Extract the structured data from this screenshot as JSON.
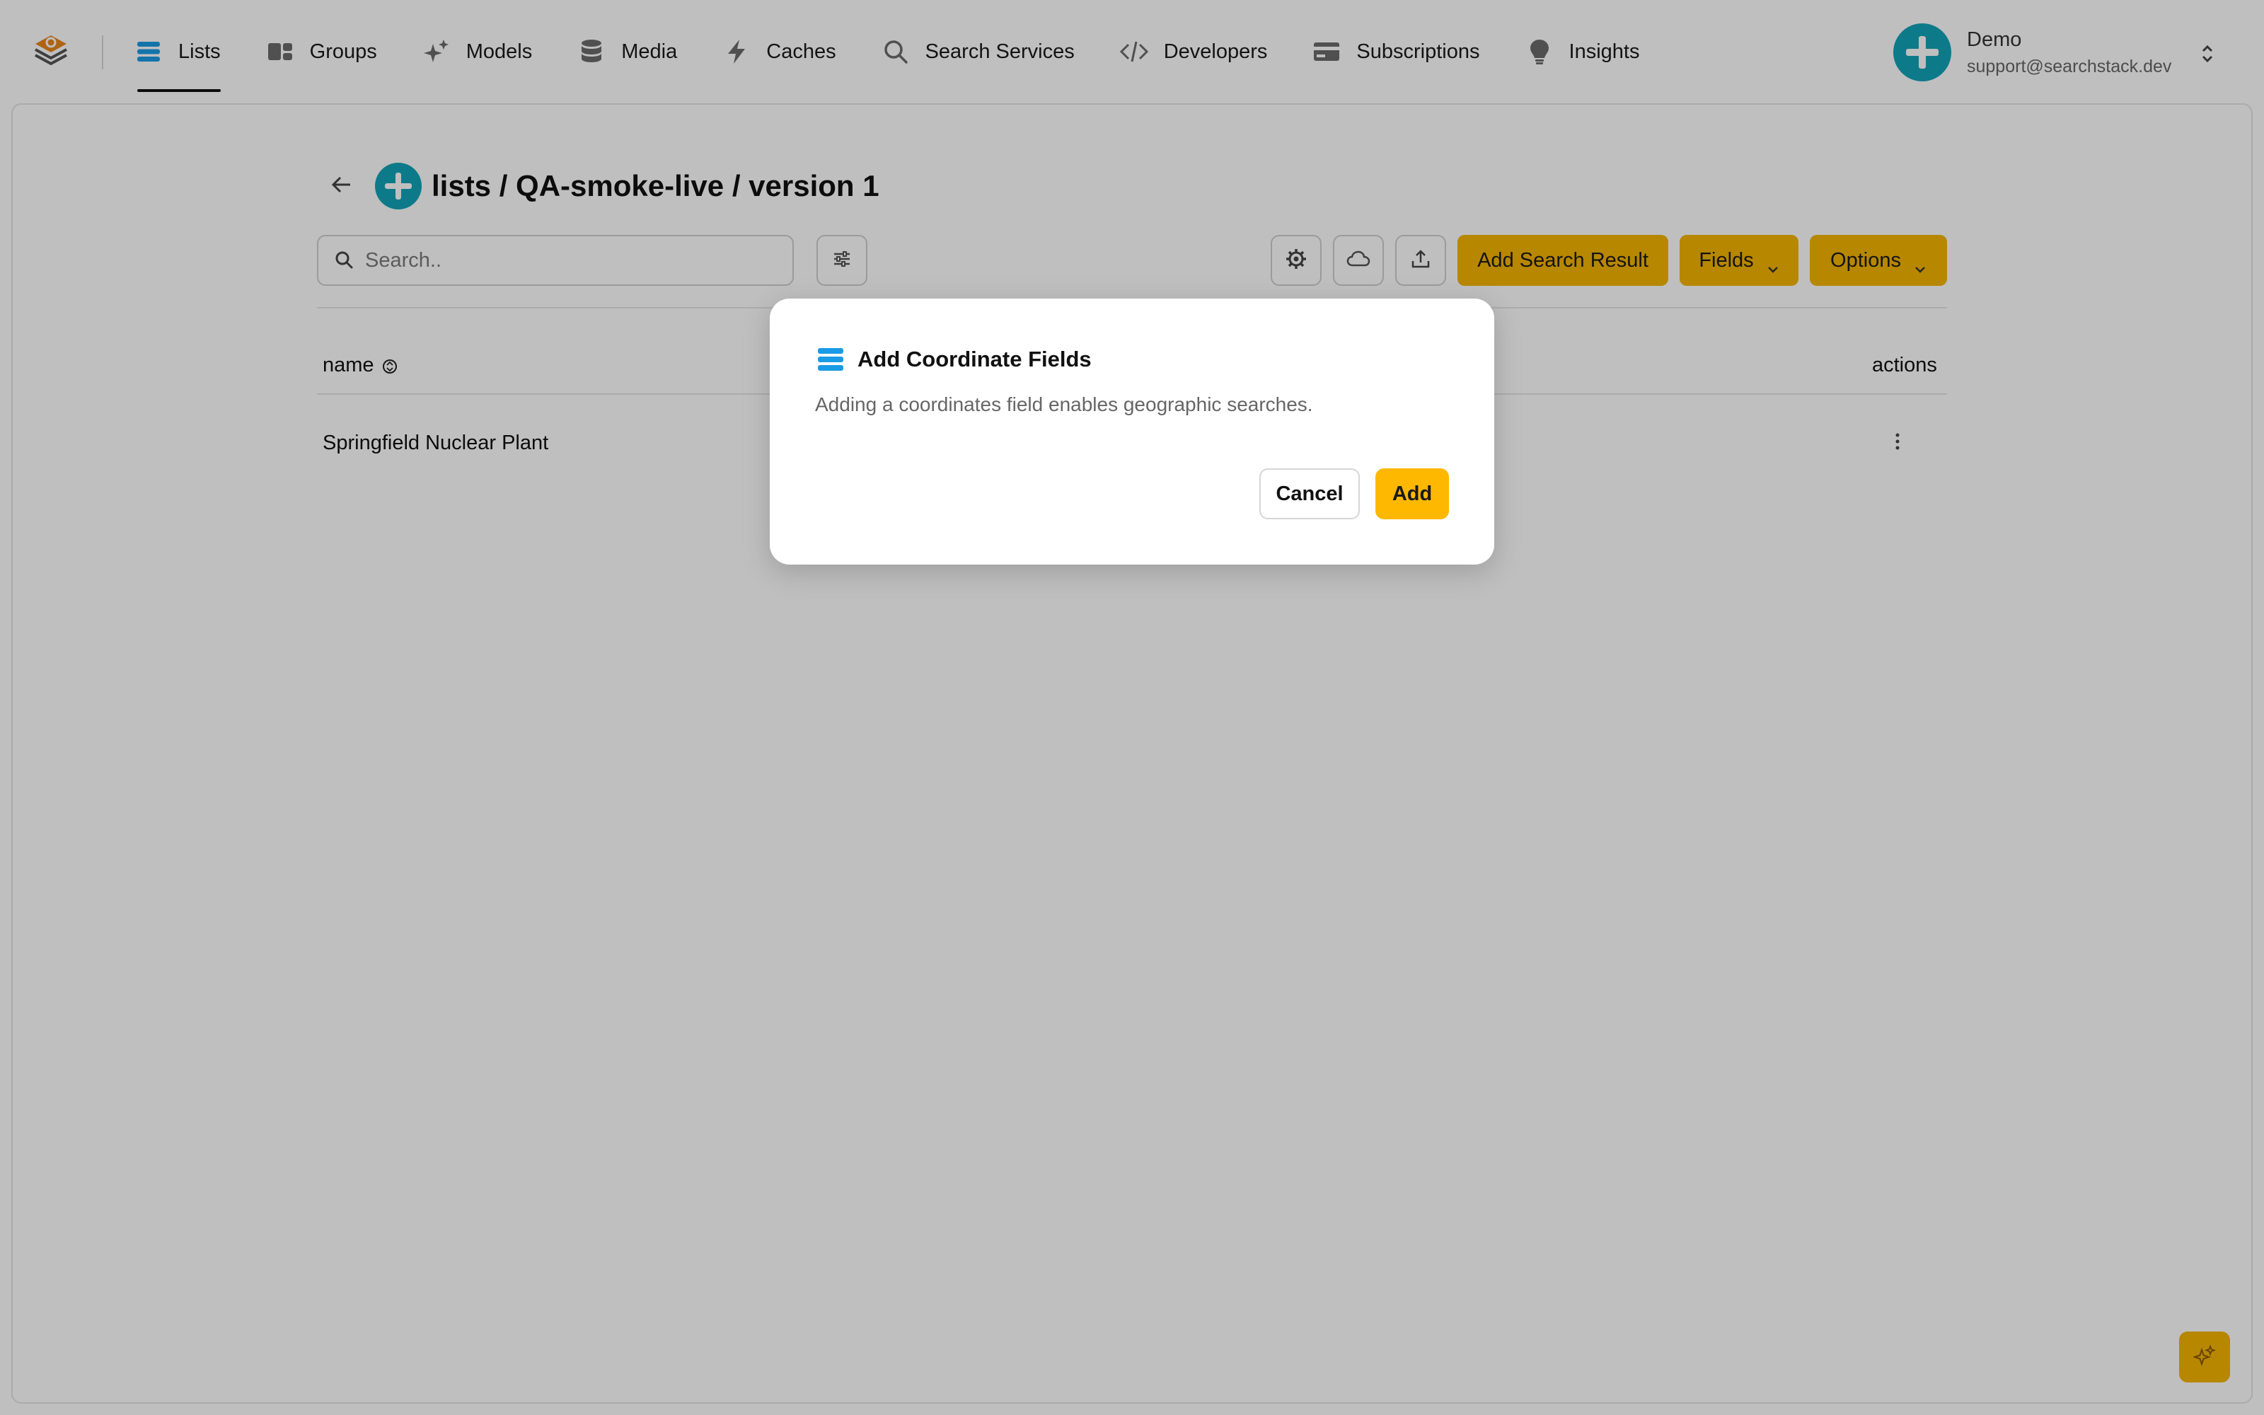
{
  "nav": {
    "items": [
      {
        "label": "Lists",
        "icon": "list-icon",
        "active": true
      },
      {
        "label": "Groups",
        "icon": "groups-icon"
      },
      {
        "label": "Models",
        "icon": "sparkles-icon"
      },
      {
        "label": "Media",
        "icon": "database-icon"
      },
      {
        "label": "Caches",
        "icon": "lightning-icon"
      },
      {
        "label": "Search Services",
        "icon": "search-icon"
      },
      {
        "label": "Developers",
        "icon": "code-icon"
      },
      {
        "label": "Subscriptions",
        "icon": "credit-card-icon"
      },
      {
        "label": "Insights",
        "icon": "lightbulb-icon"
      }
    ]
  },
  "user": {
    "name": "Demo",
    "email": "support@searchstack.dev"
  },
  "page": {
    "title": "lists / QA-smoke-live / version 1"
  },
  "toolbar": {
    "search_placeholder": "Search..",
    "add_result_label": "Add Search Result",
    "fields_label": "Fields",
    "options_label": "Options"
  },
  "table": {
    "columns": [
      "name",
      "actions"
    ],
    "rows": [
      {
        "name": "Springfield Nuclear Plant"
      }
    ]
  },
  "modal": {
    "title": "Add Coordinate Fields",
    "description": "Adding a coordinates field enables geographic searches.",
    "cancel_label": "Cancel",
    "add_label": "Add"
  },
  "colors": {
    "accent": "#f5b400",
    "avatar": "#12a3b8",
    "list_icon": "#1a9be6"
  }
}
